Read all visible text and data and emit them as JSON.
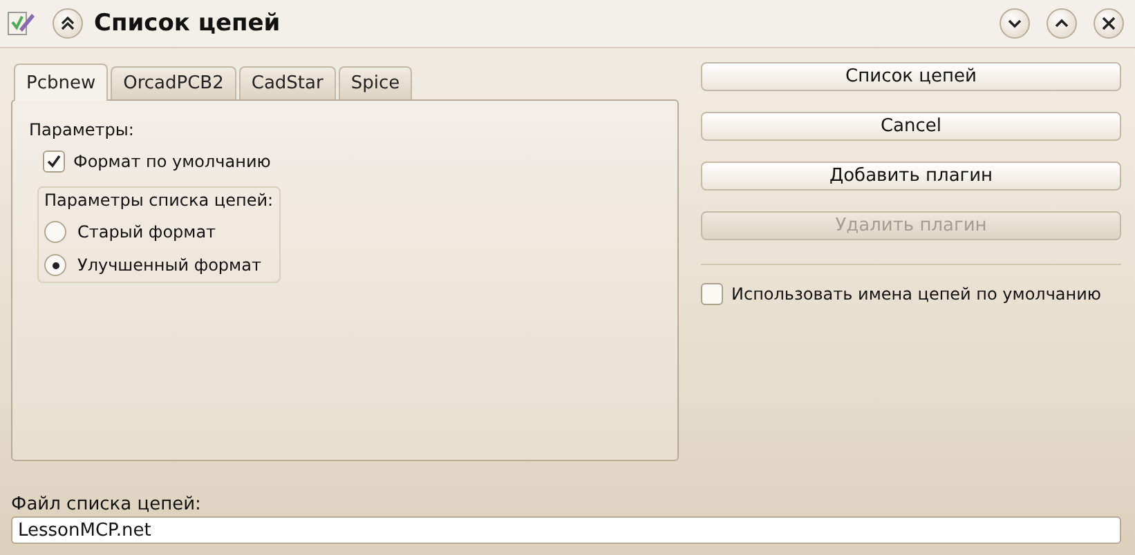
{
  "window": {
    "title": "Список цепей"
  },
  "tabs": [
    {
      "label": "Pcbnew",
      "selected": true
    },
    {
      "label": "OrcadPCB2",
      "selected": false
    },
    {
      "label": "CadStar",
      "selected": false
    },
    {
      "label": "Spice",
      "selected": false
    }
  ],
  "panel": {
    "heading": "Параметры:",
    "default_format": {
      "label": "Формат по умолчанию",
      "checked": true
    },
    "group": {
      "title": "Параметры списка цепей:",
      "options": [
        {
          "label": "Старый формат",
          "selected": false
        },
        {
          "label": "Улучшенный формат",
          "selected": true
        }
      ]
    }
  },
  "buttons": [
    {
      "label": "Список цепей",
      "disabled": false
    },
    {
      "label": "Cancel",
      "disabled": false
    },
    {
      "label": "Добавить плагин",
      "disabled": false
    },
    {
      "label": "Удалить плагин",
      "disabled": true
    }
  ],
  "use_default_names": {
    "label": "Использовать имена цепей по умолчанию",
    "checked": false
  },
  "file": {
    "label": "Файл списка цепей:",
    "value": "LessonMCP.net"
  }
}
